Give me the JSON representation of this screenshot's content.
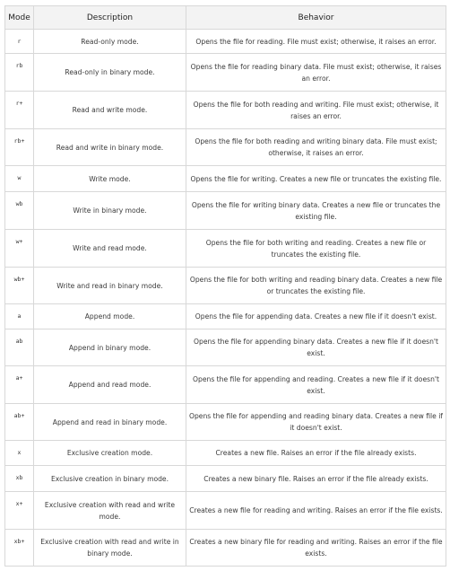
{
  "table": {
    "headers": {
      "mode": "Mode",
      "description": "Description",
      "behavior": "Behavior"
    },
    "rows": [
      {
        "mode": "r",
        "description": "Read-only mode.",
        "behavior": "Opens the file for reading. File must exist; otherwise, it raises an error."
      },
      {
        "mode": "rb",
        "description": "Read-only in binary mode.",
        "behavior": "Opens the file for reading binary data. File must exist; otherwise, it raises an error."
      },
      {
        "mode": "r+",
        "description": "Read and write mode.",
        "behavior": "Opens the file for both reading and writing. File must exist; otherwise, it raises an error."
      },
      {
        "mode": "rb+",
        "description": "Read and write in binary mode.",
        "behavior": "Opens the file for both reading and writing binary data. File must exist; otherwise, it raises an error."
      },
      {
        "mode": "w",
        "description": "Write mode.",
        "behavior": "Opens the file for writing. Creates a new file or truncates the existing file."
      },
      {
        "mode": "wb",
        "description": "Write in binary mode.",
        "behavior": "Opens the file for writing binary data. Creates a new file or truncates the existing file."
      },
      {
        "mode": "w+",
        "description": "Write and read mode.",
        "behavior": "Opens the file for both writing and reading. Creates a new file or truncates the existing file."
      },
      {
        "mode": "wb+",
        "description": "Write and read in binary mode.",
        "behavior": "Opens the file for both writing and reading binary data. Creates a new file or truncates the existing file."
      },
      {
        "mode": "a",
        "description": "Append mode.",
        "behavior": "Opens the file for appending data. Creates a new file if it doesn't exist."
      },
      {
        "mode": "ab",
        "description": "Append in binary mode.",
        "behavior": "Opens the file for appending binary data. Creates a new file if it doesn't exist."
      },
      {
        "mode": "a+",
        "description": "Append and read mode.",
        "behavior": "Opens the file for appending and reading. Creates a new file if it doesn't exist."
      },
      {
        "mode": "ab+",
        "description": "Append and read in binary mode.",
        "behavior": "Opens the file for appending and reading binary data. Creates a new file if it doesn't exist."
      },
      {
        "mode": "x",
        "description": "Exclusive creation mode.",
        "behavior": "Creates a new file. Raises an error if the file already exists."
      },
      {
        "mode": "xb",
        "description": "Exclusive creation in binary mode.",
        "behavior": "Creates a new binary file. Raises an error if the file already exists."
      },
      {
        "mode": "x+",
        "description": "Exclusive creation with read and write mode.",
        "behavior": "Creates a new file for reading and writing. Raises an error if the file exists."
      },
      {
        "mode": "xb+",
        "description": "Exclusive creation with read and write in binary mode.",
        "behavior": "Creates a new binary file for reading and writing. Raises an error if the file exists."
      }
    ]
  }
}
